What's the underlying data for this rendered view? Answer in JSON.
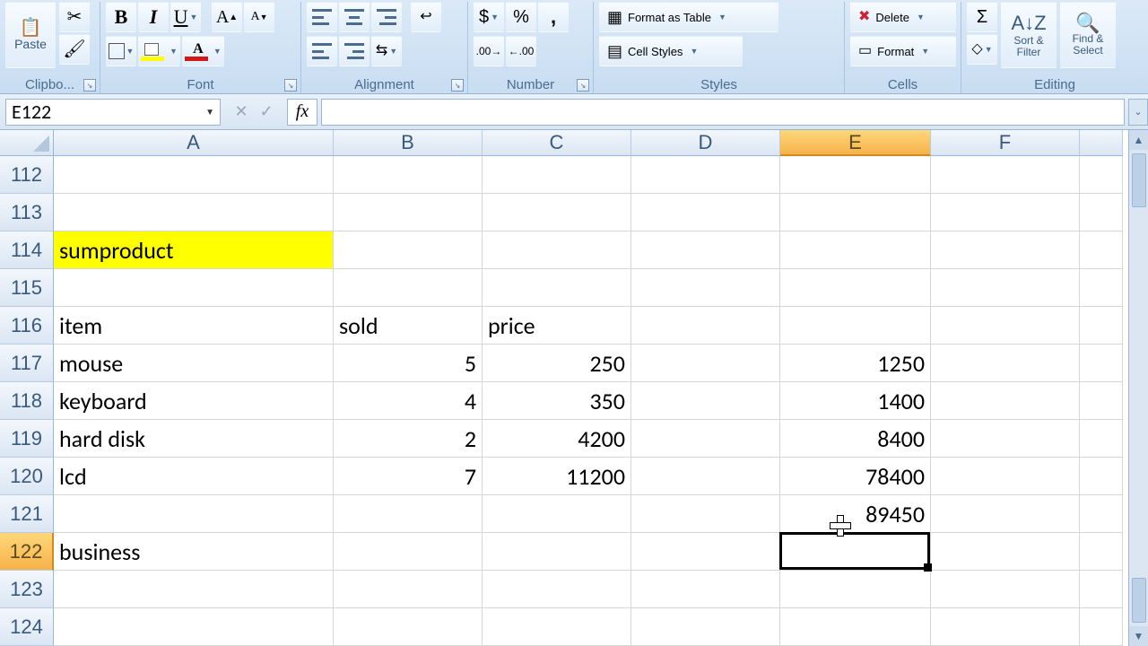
{
  "ribbon": {
    "clipboard": {
      "label": "Clipbo...",
      "paste": "Paste"
    },
    "font": {
      "label": "Font"
    },
    "alignment": {
      "label": "Alignment"
    },
    "number": {
      "label": "Number"
    },
    "styles": {
      "label": "Styles",
      "format_as_table": "Format as Table",
      "cell_styles": "Cell Styles"
    },
    "cells": {
      "label": "Cells",
      "delete": "Delete",
      "format": "Format"
    },
    "editing": {
      "label": "Editing",
      "sort_filter": "Sort & Filter",
      "find_select": "Find & Select"
    },
    "bold": "B",
    "italic": "I",
    "underline": "U"
  },
  "formula_bar": {
    "name_box": "E122",
    "formula": ""
  },
  "columns": [
    "A",
    "B",
    "C",
    "D",
    "E",
    "F",
    ""
  ],
  "selected_column_index": 4,
  "rows_start": 112,
  "rows": [
    112,
    113,
    114,
    115,
    116,
    117,
    118,
    119,
    120,
    121,
    122,
    123,
    124
  ],
  "selected_row_index": 10,
  "cells": {
    "A114": "sumproduct",
    "A116": "item",
    "B116": "sold",
    "C116": "price",
    "A117": "mouse",
    "B117": "5",
    "C117": "250",
    "E117": "1250",
    "A118": "keyboard",
    "B118": "4",
    "C118": "350",
    "E118": "1400",
    "A119": "hard disk",
    "B119": "2",
    "C119": "4200",
    "E119": "8400",
    "A120": "lcd",
    "B120": "7",
    "C120": "11200",
    "E120": "78400",
    "E121": "89450",
    "A122": "business"
  },
  "highlight_cells": [
    "A114"
  ],
  "selected_cell": "E122"
}
